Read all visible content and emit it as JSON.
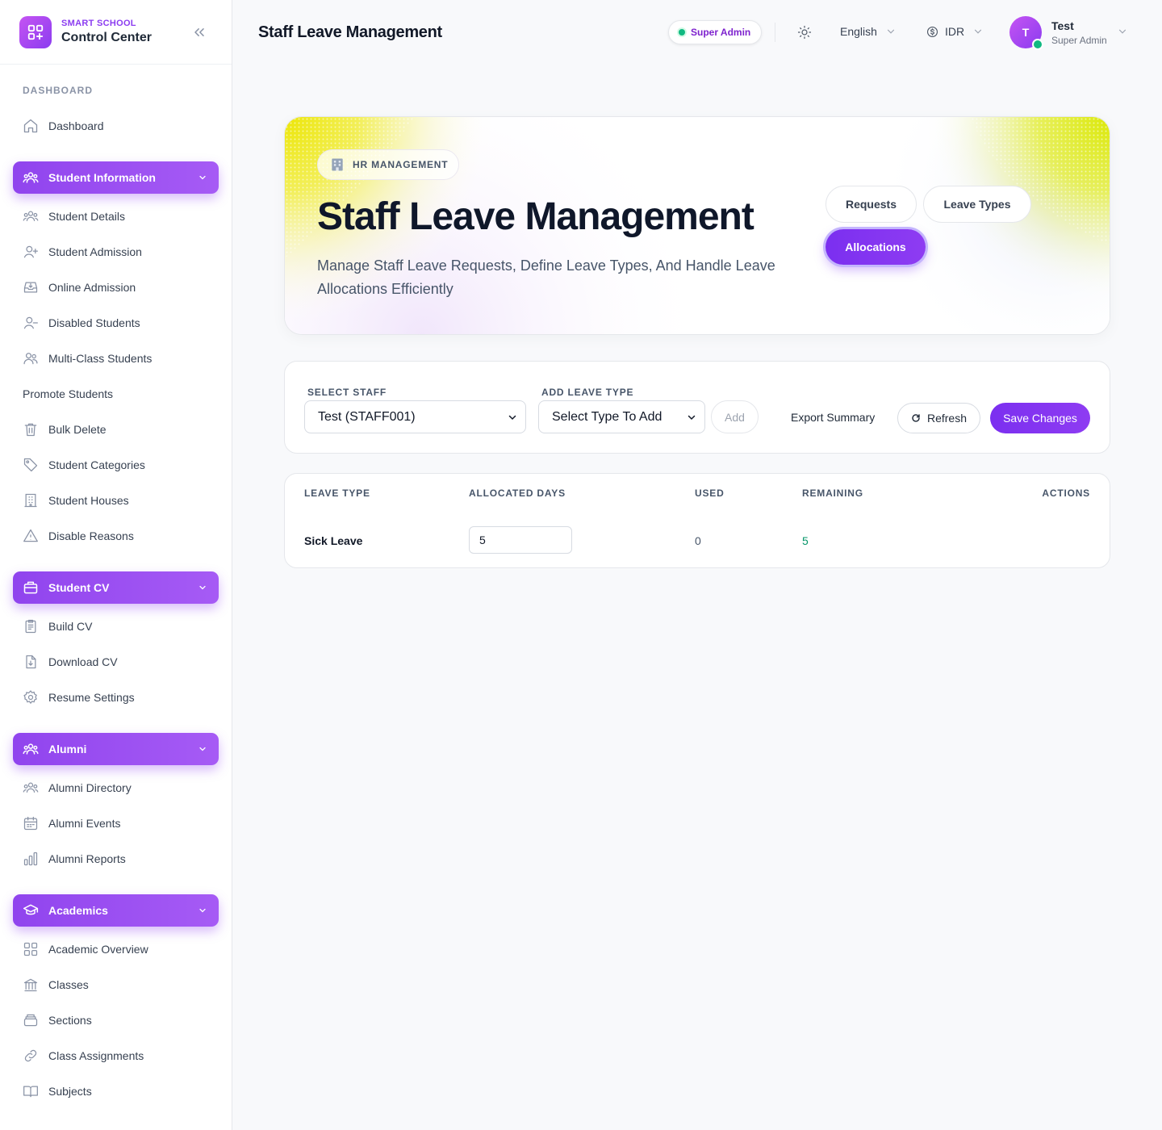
{
  "brand": {
    "subtitle": "SMART SCHOOL",
    "title": "Control Center"
  },
  "sidebar": {
    "dashboard_heading": "DASHBOARD",
    "dashboard_item": "Dashboard",
    "groups": [
      {
        "label": "Student Information",
        "items": [
          "Student Details",
          "Student Admission",
          "Online Admission",
          "Disabled Students",
          "Multi-Class Students",
          "Promote Students",
          "Bulk Delete",
          "Student Categories",
          "Student Houses",
          "Disable Reasons"
        ]
      },
      {
        "label": "Student CV",
        "items": [
          "Build CV",
          "Download CV",
          "Resume Settings"
        ]
      },
      {
        "label": "Alumni",
        "items": [
          "Alumni Directory",
          "Alumni Events",
          "Alumni Reports"
        ]
      },
      {
        "label": "Academics",
        "items": [
          "Academic Overview",
          "Classes",
          "Sections",
          "Class Assignments",
          "Subjects"
        ]
      }
    ]
  },
  "topbar": {
    "title": "Staff Leave Management",
    "role_badge": "Super Admin",
    "language": "English",
    "currency": "IDR",
    "user": {
      "initial": "T",
      "name": "Test",
      "role": "Super Admin"
    }
  },
  "hero": {
    "tag": "HR MANAGEMENT",
    "title": "Staff Leave Management",
    "description": "Manage Staff Leave Requests, Define Leave Types, And Handle Leave Allocations Efficiently",
    "tabs": [
      "Requests",
      "Leave Types",
      "Allocations"
    ],
    "active_tab": "Allocations"
  },
  "filters": {
    "staff_label": "SELECT STAFF",
    "staff_value": "Test (STAFF001)",
    "leave_type_label": "ADD LEAVE TYPE",
    "leave_type_placeholder": "Select Type To Add",
    "add_label": "Add",
    "export_label": "Export Summary",
    "refresh_label": "Refresh",
    "save_label": "Save Changes"
  },
  "table": {
    "headers": [
      "LEAVE TYPE",
      "ALLOCATED DAYS",
      "USED",
      "REMAINING",
      "ACTIONS"
    ],
    "rows": [
      {
        "leave_type": "Sick Leave",
        "allocated_days": "5",
        "used": "0",
        "remaining": "5"
      }
    ]
  },
  "colors": {
    "accent": "#8b3cf0",
    "success": "#10b981",
    "remaining": "#059669"
  }
}
